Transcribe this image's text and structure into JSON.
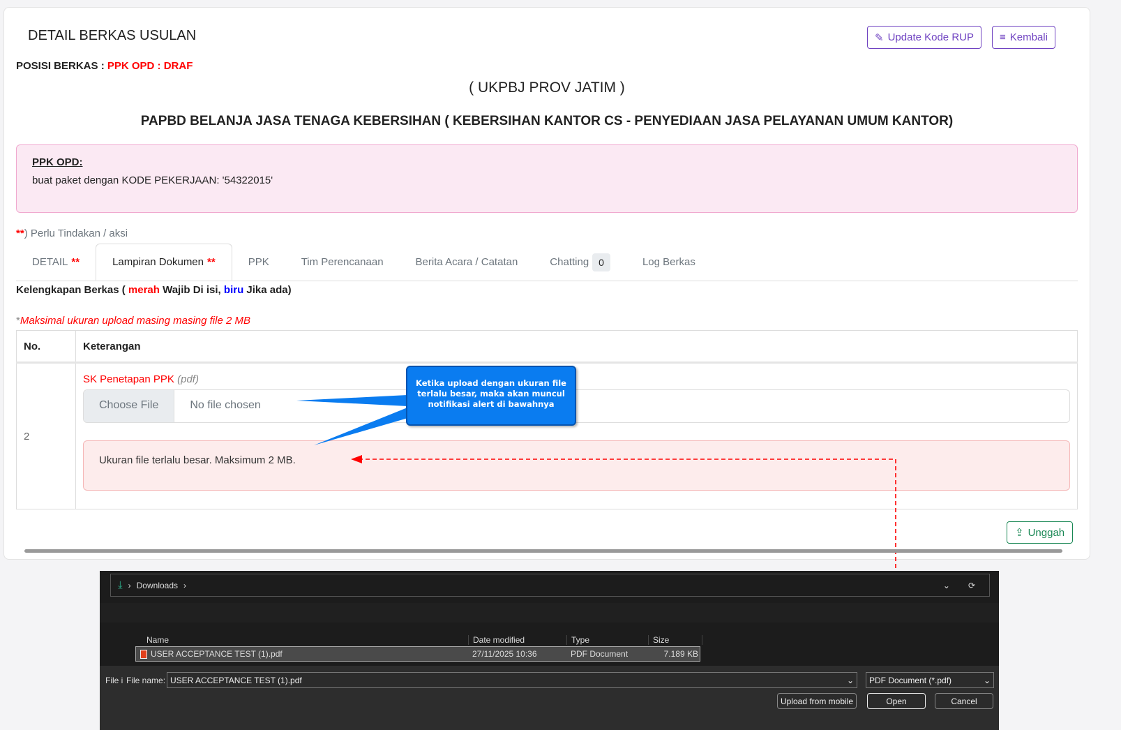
{
  "header": {
    "title": "DETAIL BERKAS USULAN",
    "update_label": "Update Kode RUP",
    "back_label": "Kembali",
    "position_label": "POSISI BERKAS : ",
    "position_value": "PPK OPD : DRAF"
  },
  "org": "( UKPBJ PROV JATIM )",
  "package_title": "PAPBD BELANJA JASA TENAGA KEBERSIHAN ( KEBERSIHAN KANTOR CS - PENYEDIAAN JASA PELAYANAN UMUM KANTOR)",
  "note": {
    "heading": "PPK OPD:",
    "text": "buat paket dengan KODE PEKERJAAN: '54322015'"
  },
  "action_note": {
    "stars": "**",
    "text": ") Perlu Tindakan / aksi"
  },
  "tabs": [
    {
      "label": "DETAIL",
      "mark": "**"
    },
    {
      "label": "Lampiran Dokumen",
      "mark": "**"
    },
    {
      "label": "PPK"
    },
    {
      "label": "Tim Perencanaan"
    },
    {
      "label": "Berita Acara / Catatan"
    },
    {
      "label": "Chatting",
      "badge": "0"
    },
    {
      "label": "Log Berkas"
    }
  ],
  "completeness": {
    "prefix": "Kelengkapan Berkas ( ",
    "red": "merah",
    "mid": " Wajib Di isi, ",
    "blue": "biru",
    "suffix": " Jika ada)"
  },
  "max_note": {
    "star": "*",
    "text": "Maksimal ukuran upload masing masing file 2 MB"
  },
  "table": {
    "headers": [
      "No.",
      "Keterangan"
    ],
    "row": {
      "no": "2",
      "doc": "SK Penetapan PPK",
      "ext": "(pdf)",
      "choose": "Choose File",
      "no_file": "No file chosen",
      "alert": "Ukuran file terlalu besar. Maksimum 2 MB."
    }
  },
  "callout": "Ketika upload dengan ukuran file terlalu besar, maka akan muncul notifikasi alert di bawahnya",
  "upload_label": "Unggah",
  "dialog": {
    "breadcrumb": "Downloads",
    "columns": [
      "Name",
      "Date modified",
      "Type",
      "Size"
    ],
    "file": {
      "name": "USER ACCEPTANCE TEST (1).pdf",
      "date": "27/11/2025 10:36",
      "type": "PDF Document",
      "size": "7.189 KB"
    },
    "filename_cut": "File i",
    "filename_label": "File name:",
    "filename_value": "USER ACCEPTANCE TEST (1).pdf",
    "filter": "PDF Document (*.pdf)",
    "mobile": "Upload from mobile",
    "open": "Open",
    "cancel": "Cancel"
  }
}
